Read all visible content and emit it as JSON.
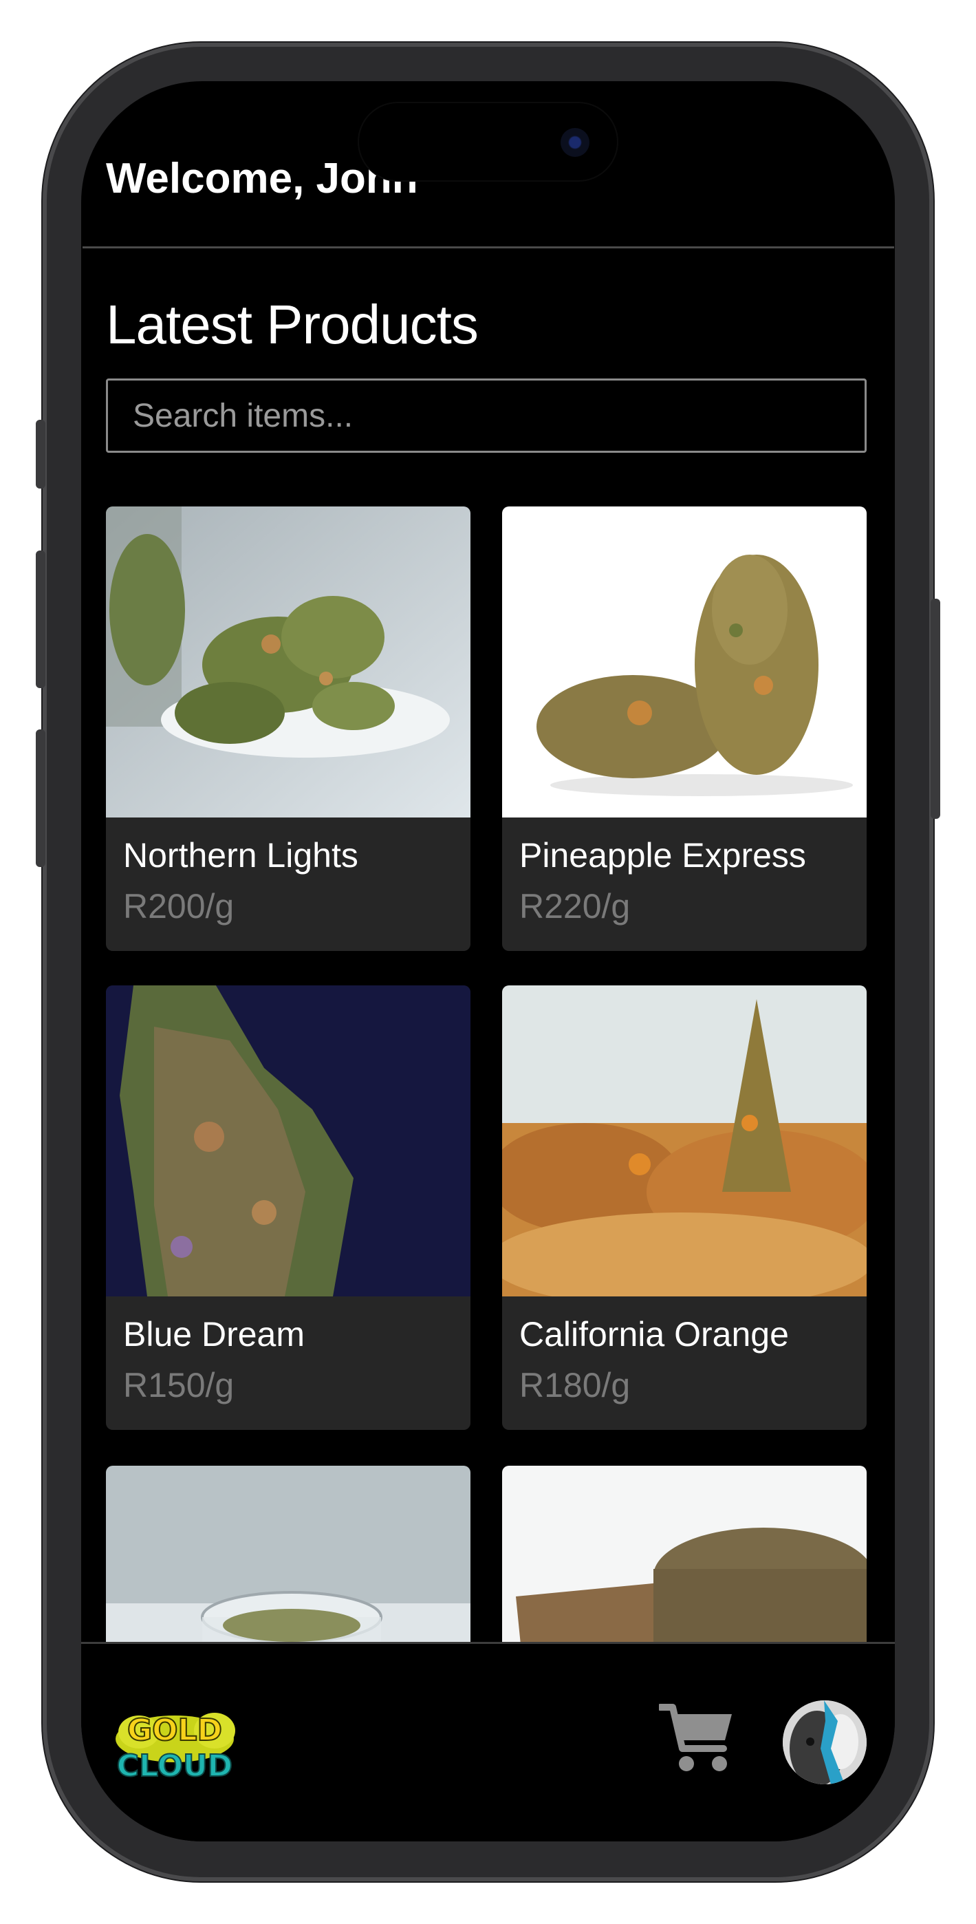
{
  "header": {
    "welcome_text": "Welcome, John"
  },
  "main": {
    "section_title": "Latest Products",
    "search_placeholder": "Search items...",
    "products": [
      {
        "name": "Northern Lights",
        "price": "R200/g"
      },
      {
        "name": "Pineapple Express",
        "price": "R220/g"
      },
      {
        "name": "Blue Dream",
        "price": "R150/g"
      },
      {
        "name": "California Orange",
        "price": "R180/g"
      },
      {
        "name": "",
        "price": ""
      },
      {
        "name": "",
        "price": ""
      }
    ]
  },
  "bottom_nav": {
    "logo_text": "GOLD CLOUD",
    "cart_icon": "shopping-cart-icon",
    "avatar_icon": "user-avatar"
  },
  "colors": {
    "background": "#000000",
    "card_background": "#262626",
    "price_text": "#7a7a7a",
    "logo_gold": "#f2d21a",
    "logo_teal": "#1fb5b0"
  }
}
